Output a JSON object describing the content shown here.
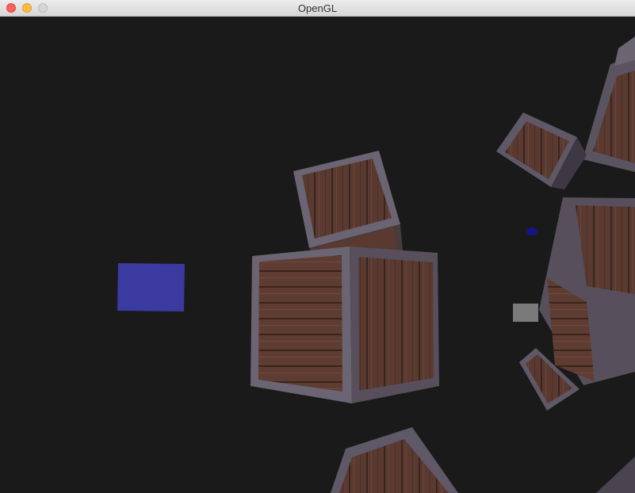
{
  "window": {
    "title": "OpenGL"
  },
  "scene": {
    "background_color": "#1a1a1a",
    "light_cube_colors": [
      "#3a3aa0",
      "#7a7a7a",
      "#14148a"
    ],
    "crate_wood_color": "#5a3a30",
    "crate_frame_color": "#6b6472"
  }
}
